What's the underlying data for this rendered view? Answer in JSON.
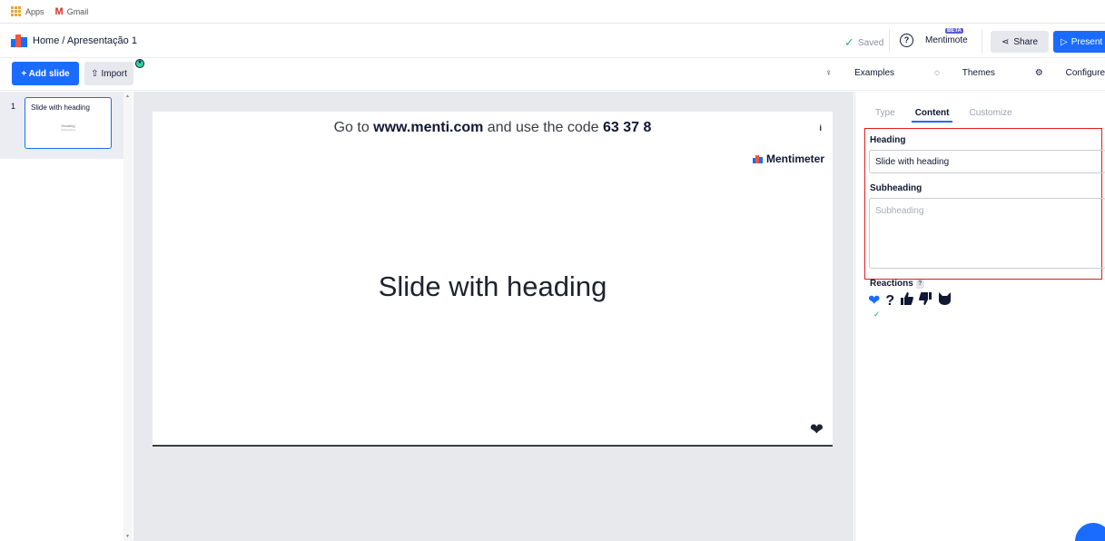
{
  "bookmarks": {
    "apps": "Apps",
    "gmail": "Gmail"
  },
  "header": {
    "breadcrumb": "Home / Apresentação 1",
    "saved": "Saved",
    "mentimote": "Mentimote",
    "beta": "BETA",
    "share": "Share",
    "present": "Present"
  },
  "toolbar": {
    "add_slide": "+ Add slide",
    "import": "Import",
    "examples": "Examples",
    "themes": "Themes",
    "configure": "Configure"
  },
  "slides": [
    {
      "number": "1",
      "title": "Slide with heading",
      "thumb_heading": "Heading",
      "thumb_sub": "Subheading"
    }
  ],
  "canvas": {
    "join_prefix": "Go to ",
    "join_url": "www.menti.com",
    "join_middle": " and use the code ",
    "join_code": "63 37 8",
    "info": "i",
    "brand": "Mentimeter",
    "heading": "Slide with heading"
  },
  "panel": {
    "tabs": [
      "Type",
      "Content",
      "Customize"
    ],
    "active_tab": "Content",
    "heading_label": "Heading",
    "heading_value": "Slide with heading",
    "subheading_label": "Subheading",
    "subheading_placeholder": "Subheading",
    "reactions_label": "Reactions",
    "reactions_help": "?",
    "reactions": [
      "heart-icon",
      "question-icon",
      "thumbs-up-icon",
      "thumbs-down-icon",
      "cat-icon"
    ]
  },
  "colors": {
    "accent": "#196cff",
    "highlight": "#e21b1b",
    "success": "#2bb673"
  }
}
